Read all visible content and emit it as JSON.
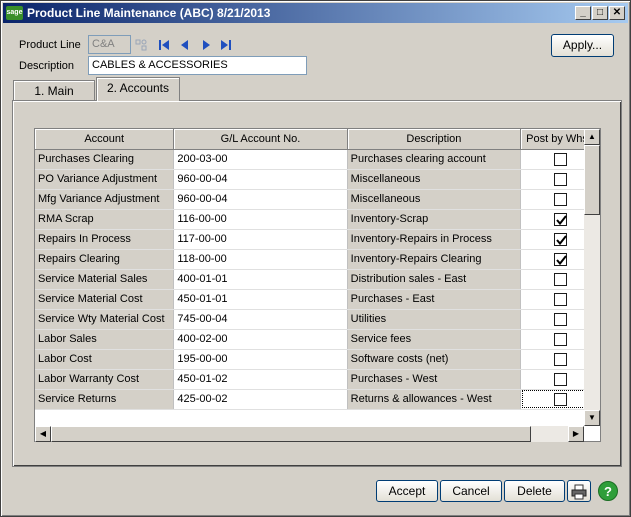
{
  "window": {
    "app_icon_text": "sage",
    "title": "Product Line Maintenance (ABC) 8/21/2013",
    "minimize_glyph": "_",
    "maximize_glyph": "□",
    "close_glyph": "✕"
  },
  "header": {
    "product_line_label": "Product Line",
    "product_line_value": "C&A",
    "description_label": "Description",
    "description_value": "CABLES & ACCESSORIES",
    "apply_label": "Apply..."
  },
  "tabs": [
    {
      "label": "1. Main",
      "active": false
    },
    {
      "label": "2. Accounts",
      "active": true
    }
  ],
  "grid": {
    "columns": [
      "Account",
      "G/L Account No.",
      "Description",
      "Post by Whse"
    ],
    "rows": [
      {
        "account": "Purchases Clearing",
        "gl": "200-03-00",
        "desc": "Purchases clearing account",
        "post": false
      },
      {
        "account": "PO Variance Adjustment",
        "gl": "960-00-04",
        "desc": "Miscellaneous",
        "post": false
      },
      {
        "account": "Mfg Variance Adjustment",
        "gl": "960-00-04",
        "desc": "Miscellaneous",
        "post": false
      },
      {
        "account": "RMA Scrap",
        "gl": "116-00-00",
        "desc": "Inventory-Scrap",
        "post": true
      },
      {
        "account": "Repairs In Process",
        "gl": "117-00-00",
        "desc": "Inventory-Repairs in Process",
        "post": true
      },
      {
        "account": "Repairs Clearing",
        "gl": "118-00-00",
        "desc": "Inventory-Repairs Clearing",
        "post": true
      },
      {
        "account": "Service Material Sales",
        "gl": "400-01-01",
        "desc": "Distribution sales - East",
        "post": false
      },
      {
        "account": "Service Material Cost",
        "gl": "450-01-01",
        "desc": "Purchases - East",
        "post": false
      },
      {
        "account": "Service Wty Material Cost",
        "gl": "745-00-04",
        "desc": "Utilities",
        "post": false
      },
      {
        "account": "Labor Sales",
        "gl": "400-02-00",
        "desc": "Service fees",
        "post": false
      },
      {
        "account": "Labor Cost",
        "gl": "195-00-00",
        "desc": "Software costs (net)",
        "post": false
      },
      {
        "account": "Labor Warranty Cost",
        "gl": "450-01-02",
        "desc": "Purchases - West",
        "post": false
      },
      {
        "account": "Service Returns",
        "gl": "425-00-02",
        "desc": "Returns & allowances - West",
        "post": false
      }
    ]
  },
  "footer": {
    "accept_label": "Accept",
    "cancel_label": "Cancel",
    "delete_label": "Delete",
    "help_glyph": "?"
  },
  "icons": {
    "lookup": "lookup-icon",
    "first": "first-record-icon",
    "previous": "previous-record-icon",
    "next": "next-record-icon",
    "last": "last-record-icon",
    "print": "printer-icon",
    "help": "help-icon"
  },
  "colors": {
    "nav_arrow": "#1f4fbf",
    "help_green": "#2f9e3a",
    "title_gradient_start": "#0a246a",
    "title_gradient_end": "#a6caf0"
  }
}
